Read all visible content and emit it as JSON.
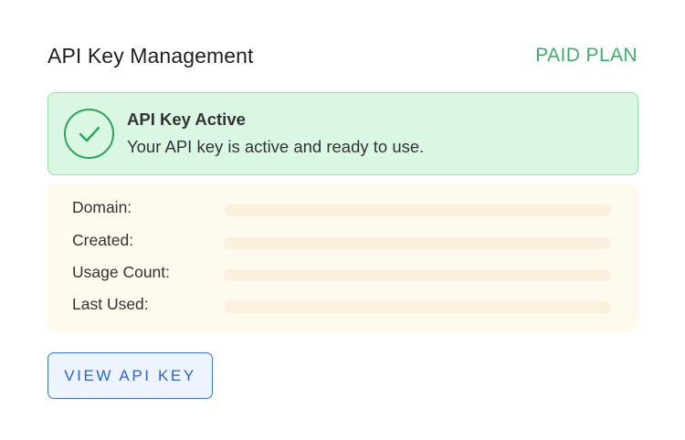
{
  "header": {
    "title": "API Key Management",
    "plan_badge": "PAID PLAN"
  },
  "status": {
    "icon": "check-circle-icon",
    "title": "API Key Active",
    "message": "Your API key is active and ready to use."
  },
  "details": {
    "rows": [
      {
        "label": "Domain:"
      },
      {
        "label": "Created:"
      },
      {
        "label": "Usage Count:"
      },
      {
        "label": "Last Used:"
      }
    ]
  },
  "actions": {
    "view_key_label": "VIEW API KEY"
  },
  "colors": {
    "success_green": "#3fae68",
    "success_bg": "#d9f7e3",
    "details_bg": "#fff9ee",
    "button_blue": "#2b63cf"
  }
}
